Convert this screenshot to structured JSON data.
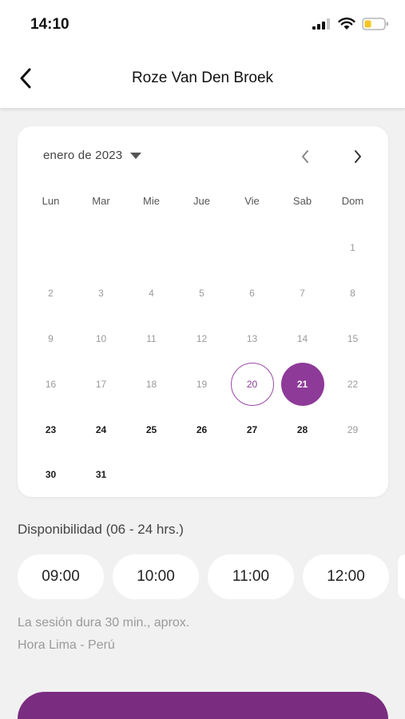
{
  "status_bar": {
    "time": "14:10"
  },
  "header": {
    "title": "Roze Van Den Broek"
  },
  "calendar": {
    "month_label": "enero de 2023",
    "weekdays": [
      "Lun",
      "Mar",
      "Mie",
      "Jue",
      "Vie",
      "Sab",
      "Dom"
    ],
    "days": [
      {
        "n": "",
        "state": "empty"
      },
      {
        "n": "",
        "state": "empty"
      },
      {
        "n": "",
        "state": "empty"
      },
      {
        "n": "",
        "state": "empty"
      },
      {
        "n": "",
        "state": "empty"
      },
      {
        "n": "",
        "state": "empty"
      },
      {
        "n": "1",
        "state": "disabled"
      },
      {
        "n": "2",
        "state": "disabled"
      },
      {
        "n": "3",
        "state": "disabled"
      },
      {
        "n": "4",
        "state": "disabled"
      },
      {
        "n": "5",
        "state": "disabled"
      },
      {
        "n": "6",
        "state": "disabled"
      },
      {
        "n": "7",
        "state": "disabled"
      },
      {
        "n": "8",
        "state": "disabled"
      },
      {
        "n": "9",
        "state": "disabled"
      },
      {
        "n": "10",
        "state": "disabled"
      },
      {
        "n": "11",
        "state": "disabled"
      },
      {
        "n": "12",
        "state": "disabled"
      },
      {
        "n": "13",
        "state": "disabled"
      },
      {
        "n": "14",
        "state": "disabled"
      },
      {
        "n": "15",
        "state": "disabled"
      },
      {
        "n": "16",
        "state": "disabled"
      },
      {
        "n": "17",
        "state": "disabled"
      },
      {
        "n": "18",
        "state": "disabled"
      },
      {
        "n": "19",
        "state": "disabled"
      },
      {
        "n": "20",
        "state": "today"
      },
      {
        "n": "21",
        "state": "selected"
      },
      {
        "n": "22",
        "state": "disabled"
      },
      {
        "n": "23",
        "state": "available"
      },
      {
        "n": "24",
        "state": "available"
      },
      {
        "n": "25",
        "state": "available"
      },
      {
        "n": "26",
        "state": "available"
      },
      {
        "n": "27",
        "state": "available"
      },
      {
        "n": "28",
        "state": "available"
      },
      {
        "n": "29",
        "state": "disabled"
      },
      {
        "n": "30",
        "state": "available"
      },
      {
        "n": "31",
        "state": "available"
      }
    ]
  },
  "availability": {
    "label": "Disponibilidad (06 - 24 hrs.)",
    "slots": [
      "09:00",
      "10:00",
      "11:00",
      "12:00"
    ]
  },
  "notes": {
    "duration": "La sesión dura 30 min., aprox.",
    "timezone": "Hora Lima - Perú"
  },
  "colors": {
    "accent": "#8e3a99",
    "cta": "#7a2c80",
    "background": "#f1f1f1"
  },
  "icons": {
    "back": "chevron-left-icon",
    "month_dropdown": "caret-down-icon",
    "prev_month": "chevron-left-icon",
    "next_month": "chevron-right-icon"
  }
}
